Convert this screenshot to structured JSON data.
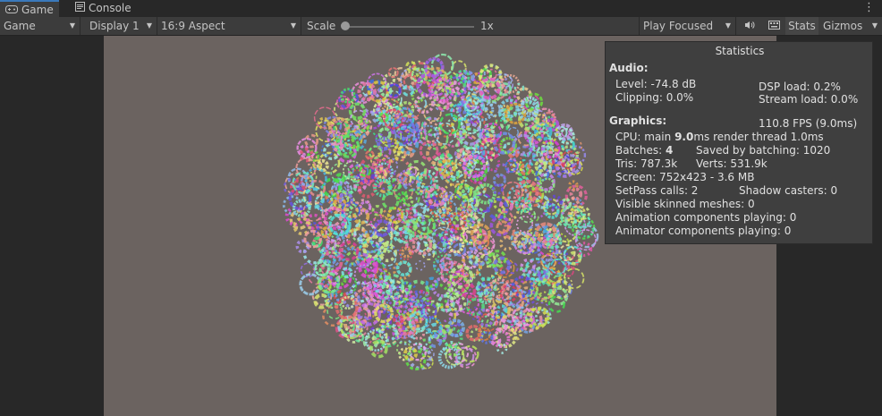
{
  "tabs": [
    {
      "label": "Game",
      "icon": "gamepad-icon"
    },
    {
      "label": "Console",
      "icon": "console-icon"
    }
  ],
  "toolbar": {
    "view": "Game",
    "display": "Display 1",
    "aspect": "16:9 Aspect",
    "scale_label": "Scale",
    "scale_value": "1x",
    "play_mode": "Play Focused",
    "stats_label": "Stats",
    "gizmos_label": "Gizmos"
  },
  "stats": {
    "title": "Statistics",
    "audio_header": "Audio:",
    "level": "Level: -74.8 dB",
    "dsp_load": "DSP load: 0.2%",
    "clipping": "Clipping: 0.0%",
    "stream_load": "Stream load: 0.0%",
    "graphics_header": "Graphics:",
    "fps": "110.8 FPS (9.0ms)",
    "cpu_prefix": "CPU: main ",
    "cpu_main": "9.0",
    "cpu_suffix": "ms  render thread 1.0ms",
    "batches_prefix": "Batches: ",
    "batches": "4",
    "saved_batching": "Saved by batching: 1020",
    "tris": "Tris: 787.3k",
    "verts": "Verts: 531.9k",
    "screen": "Screen: 752x423 - 3.6 MB",
    "setpass": "SetPass calls: 2",
    "shadow_casters": "Shadow casters: 0",
    "skinned": "Visible skinned meshes: 0",
    "animation": "Animation components playing: 0",
    "animator": "Animator components playing: 0"
  },
  "colors": {
    "accent": "#3a79bb",
    "viewport_bg": "#6b6360",
    "panel_bg": "#3f3f3f"
  }
}
